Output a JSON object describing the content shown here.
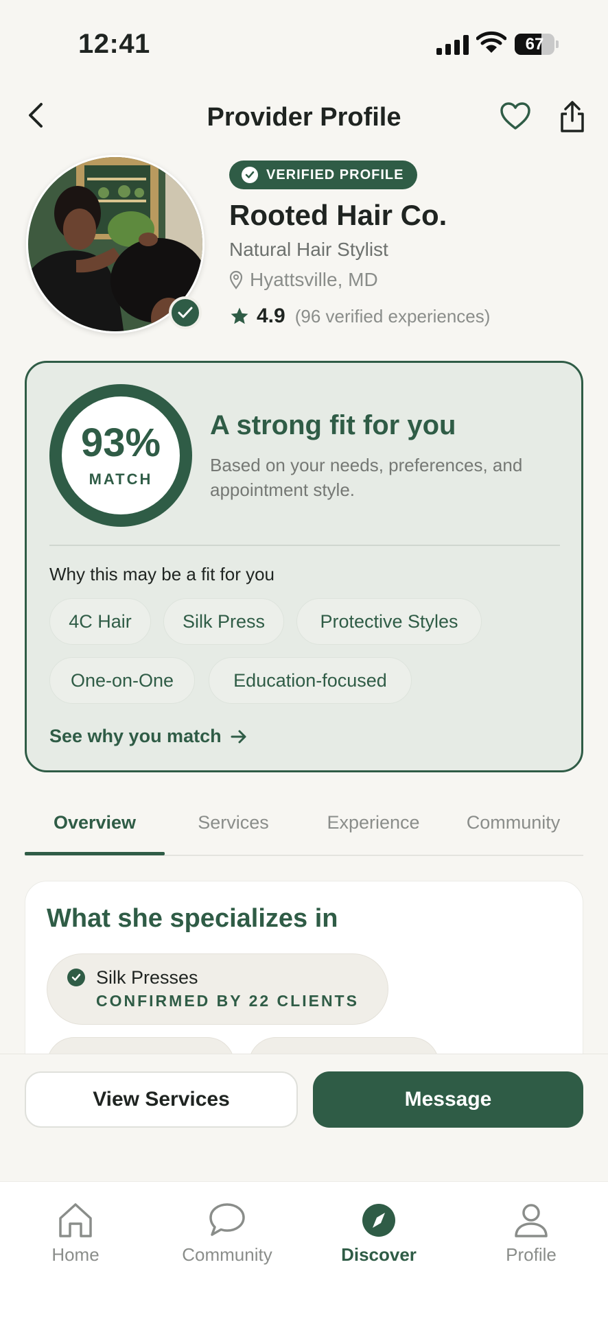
{
  "status_bar": {
    "time": "12:41",
    "battery": "67",
    "battery_level": 0.67
  },
  "header": {
    "title": "Provider Profile",
    "back_icon": "chevron-left-icon",
    "favorite_icon": "heart-icon",
    "share_icon": "share-icon"
  },
  "profile": {
    "verified_label": "VERIFIED PROFILE",
    "name": "Rooted Hair Co.",
    "role": "Natural Hair Stylist",
    "location": "Hyattsville, MD",
    "rating": "4.9",
    "rating_count": "(96 verified experiences)"
  },
  "match": {
    "percent": "93%",
    "percent_value": 93,
    "label": "MATCH",
    "heading": "A strong fit for you",
    "description": "Based on your needs, preferences, and appointment style.",
    "why_title": "Why this may be a fit for you",
    "chips": [
      "4C Hair",
      "Silk Press",
      "Protective Styles",
      "One-on-One",
      "Education-focused"
    ],
    "see_why": "See why you match"
  },
  "tabs": [
    {
      "label": "Overview",
      "active": true
    },
    {
      "label": "Services",
      "active": false
    },
    {
      "label": "Experience",
      "active": false
    },
    {
      "label": "Community",
      "active": false
    }
  ],
  "specializes": {
    "title": "What she specializes in",
    "items": [
      {
        "name": "Silk Presses",
        "confirmation": "CONFIRMED BY 22 CLIENTS"
      }
    ]
  },
  "actions": {
    "view_services": "View Services",
    "message": "Message"
  },
  "bottom_nav": [
    {
      "label": "Home",
      "icon": "home-icon",
      "active": false
    },
    {
      "label": "Community",
      "icon": "chat-bubble-icon",
      "active": false
    },
    {
      "label": "Discover",
      "icon": "compass-icon",
      "active": true
    },
    {
      "label": "Profile",
      "icon": "person-icon",
      "active": false
    }
  ],
  "colors": {
    "brand": "#2f5c46",
    "card_bg": "#e6ebe5",
    "page_bg": "#f7f6f2",
    "muted": "#8a8d8a"
  }
}
